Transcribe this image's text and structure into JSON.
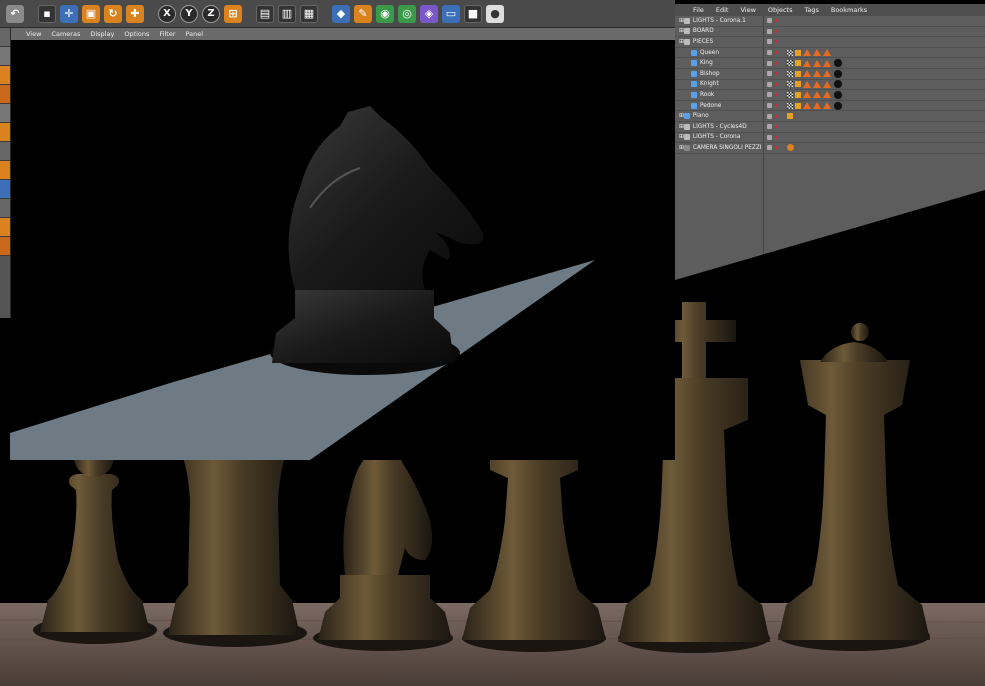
{
  "toolbar": {
    "axis_x": "X",
    "axis_y": "Y",
    "axis_z": "Z"
  },
  "viewport_menu": [
    "View",
    "Cameras",
    "Display",
    "Options",
    "Filter",
    "Panel"
  ],
  "object_manager": {
    "menu": [
      "File",
      "Edit",
      "View",
      "Objects",
      "Tags",
      "Bookmarks"
    ],
    "objects": [
      {
        "name": "LIGHTS - Corona.1",
        "indent": 0,
        "icon": "null-icon",
        "tags": []
      },
      {
        "name": "BOARD",
        "indent": 0,
        "icon": "null-icon",
        "tags": []
      },
      {
        "name": "PIECES",
        "indent": 0,
        "icon": "null-icon",
        "tags": []
      },
      {
        "name": "Queen",
        "indent": 1,
        "icon": "lathe-icon",
        "tags": [
          "checker",
          "phong",
          "tri",
          "tri",
          "tri"
        ]
      },
      {
        "name": "King",
        "indent": 1,
        "icon": "lathe-icon",
        "tags": [
          "checker",
          "phong",
          "tri",
          "tri",
          "tri",
          "ball"
        ]
      },
      {
        "name": "Bishop",
        "indent": 1,
        "icon": "lathe-icon",
        "tags": [
          "checker",
          "phong",
          "tri",
          "tri",
          "tri",
          "ball"
        ]
      },
      {
        "name": "Knight",
        "indent": 1,
        "icon": "lathe-icon",
        "tags": [
          "checker",
          "phong",
          "tri",
          "tri",
          "tri",
          "ball"
        ]
      },
      {
        "name": "Rook",
        "indent": 1,
        "icon": "lathe-icon",
        "tags": [
          "checker",
          "phong",
          "tri",
          "tri",
          "tri",
          "ball"
        ]
      },
      {
        "name": "Pedone",
        "indent": 1,
        "icon": "lathe-icon",
        "tags": [
          "checker",
          "phong",
          "tri",
          "tri",
          "tri",
          "ball"
        ]
      },
      {
        "name": "Piano",
        "indent": 0,
        "icon": "plane-icon",
        "tags": [
          "phong"
        ]
      },
      {
        "name": "LIGHTS - Cycles4D",
        "indent": 0,
        "icon": "null-icon",
        "tags": []
      },
      {
        "name": "LIGHTS - Corona",
        "indent": 0,
        "icon": "null-icon",
        "tags": []
      },
      {
        "name": "CAMERA SINGOLI PEZZI",
        "indent": 0,
        "icon": "camera-icon",
        "tags": [
          "target"
        ]
      }
    ]
  },
  "colors": {
    "ui_panel": "#5d5d5d",
    "ui_toolbar": "#4a4a4a",
    "viewport_bg": "#000000",
    "plane_gray": "#6e7a84",
    "piece_black": "#1c1c1c",
    "piece_bronze": "#5a4a30",
    "board_wood": "#6a5a52",
    "tag_orange": "#e86a1f"
  }
}
